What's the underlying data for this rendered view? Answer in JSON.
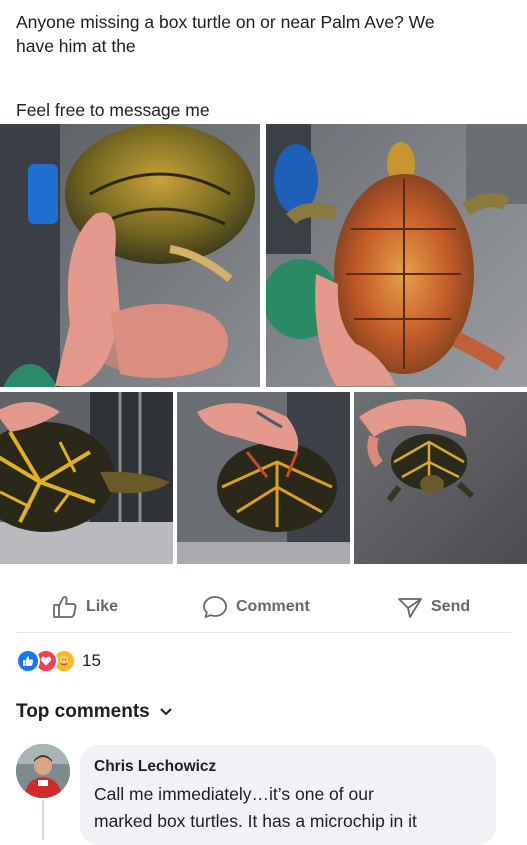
{
  "post": {
    "line1": "Anyone missing a box turtle on or near Palm Ave? We",
    "line2": "have him at the",
    "line3": "Feel free to message me"
  },
  "photos": [
    {
      "name": "turtle-photo-underside-held"
    },
    {
      "name": "turtle-photo-plastron-held-up"
    },
    {
      "name": "turtle-photo-shell-side"
    },
    {
      "name": "turtle-photo-shell-held"
    },
    {
      "name": "turtle-photo-on-table"
    }
  ],
  "actions": {
    "like_label": "Like",
    "like_icon": "thumbs-up-icon",
    "comment_label": "Comment",
    "comment_icon": "speech-bubble-icon",
    "send_label": "Send",
    "send_icon": "paper-plane-icon"
  },
  "reactions": {
    "count": "15",
    "types": [
      "like",
      "love",
      "care"
    ],
    "colors": {
      "like": "#1877f2",
      "love": "#f33e58",
      "care": "#f7b928"
    }
  },
  "comments_section": {
    "heading": "Top comments",
    "sort_icon": "chevron-down-icon"
  },
  "comment": {
    "author": "Chris Lechowicz",
    "line1": "Call me immediately…it’s one of our",
    "line2": "marked box turtles. It has a microchip in it"
  }
}
